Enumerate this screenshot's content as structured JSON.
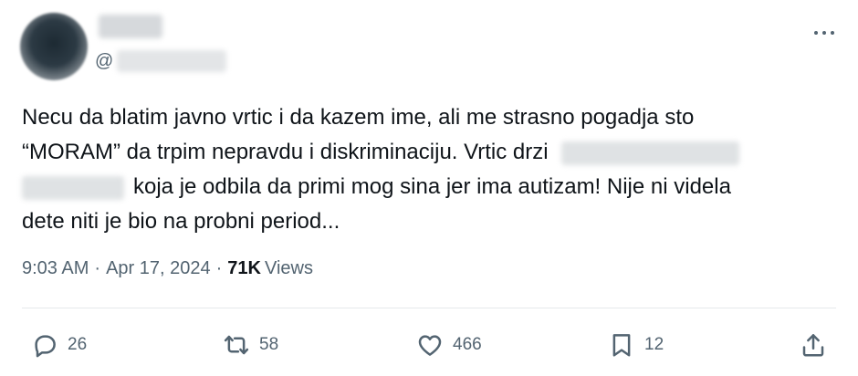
{
  "tweet": {
    "handle_prefix": "@",
    "text": {
      "line1": "Necu da blatim javno vrtic i da kazem ime, ali me strasno pogadja sto",
      "line2": "“MORAM” da trpim nepravdu i diskriminaciju. Vrtic drzi",
      "line3": "koja je odbila da primi mog sina jer ima autizam! Nije ni videla",
      "line4": "dete niti je bio na probni period..."
    },
    "time": "9:03 AM",
    "separator": "·",
    "date": "Apr 17, 2024",
    "views_count": "71K",
    "views_label": "Views"
  },
  "actions": {
    "replies": "26",
    "reposts": "58",
    "likes": "466",
    "bookmarks": "12"
  },
  "icons": {
    "reply": "reply-icon",
    "repost": "repost-icon",
    "like": "heart-icon",
    "bookmark": "bookmark-icon",
    "share": "share-icon",
    "more": "more-icon"
  },
  "colors": {
    "text": "#0f1419",
    "secondary": "#536471",
    "divider": "#e6e9eb"
  }
}
